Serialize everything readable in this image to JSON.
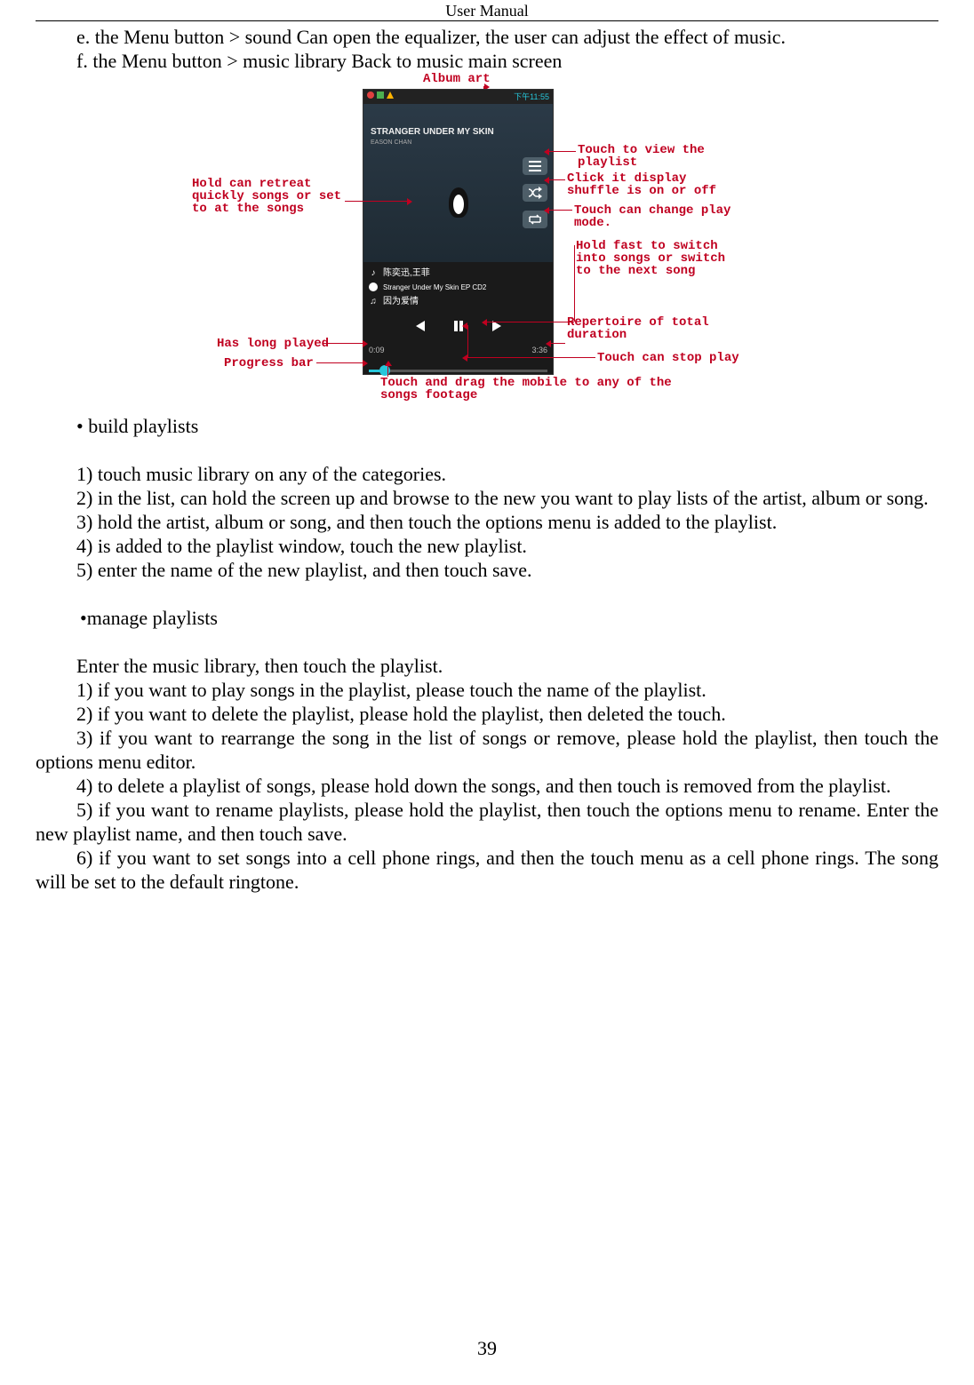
{
  "header": "User    Manual",
  "page_number": "39",
  "intro": {
    "e": "e. the Menu button > sound Can open the equalizer, the user can adjust the effect of music.",
    "f": "f. the Menu button > music library Back to music main screen"
  },
  "figure": {
    "top_label": "Album art",
    "left": {
      "hold_retreat": "Hold can retreat quickly songs or set to at the songs",
      "has_long_played": "Has long played",
      "progress_bar": "Progress bar"
    },
    "right": {
      "view_playlist": "Touch to view the playlist",
      "shuffle": "Click it display shuffle is on or off",
      "play_mode": "Touch can change play mode.",
      "hold_fast": "Hold fast to switch into songs or switch to the next song",
      "total_duration": "Repertoire of total duration",
      "stop_play": "Touch can stop play"
    },
    "bottom": "Touch and drag the mobile to any of the songs footage",
    "phone": {
      "clock": "下午11:55",
      "cover_title": "STRANGER UNDER MY SKIN",
      "cover_sub": "EASON CHAN",
      "artists": "陈奕迅,王菲",
      "album": "Stranger Under My Skin EP CD2",
      "song": "因为爱情",
      "elapsed": "0:09",
      "duration": "3:36"
    }
  },
  "build": {
    "heading": "• build playlists",
    "s1": "1) touch music library on any of the categories.",
    "s2": "2) in the list, can hold the screen up and browse to the new you want to play lists of the artist, album or song.",
    "s3": "3) hold the artist, album or song, and then touch the options menu is added to the playlist.",
    "s4": "4) is added to the playlist window, touch the new playlist.",
    "s5": "5) enter the name of the new playlist, and then touch save."
  },
  "manage": {
    "heading": " •manage playlists",
    "intro": "Enter the music library, then touch the playlist.",
    "s1": "1) if you want to play songs in the playlist, please touch the name of the playlist.",
    "s2": "2) if you want to delete the playlist, please hold the playlist, then deleted the touch.",
    "s3": "3) if you want to rearrange the song in the list of songs or remove, please hold the playlist, then touch the options menu editor.",
    "s4": "4)  to  delete  a  playlist  of  songs,  please  hold  down  the  songs,  and  then  touch  is  removed  from  the playlist.",
    "s5": "5) if you want to rename playlists, please hold  the playlist, then touch the options menu to rename. Enter the new playlist name, and then touch save.",
    "s6": "6) if you want to set songs into a cell phone rings, and then the touch menu as a cell phone rings. The song will be set to the default ringtone."
  }
}
